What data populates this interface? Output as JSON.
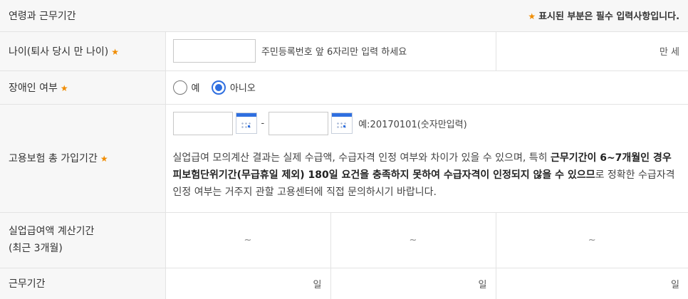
{
  "header": {
    "title": "연령과 근무기간",
    "required_note_star": "★",
    "required_note": "표시된 부분은 필수 입력사항입니다."
  },
  "age": {
    "label": "나이(퇴사 당시 만 나이)",
    "star": "★",
    "value": "",
    "hint": "주민등록번호 앞 6자리만 입력 하세요",
    "unit": "만 세"
  },
  "disability": {
    "label": "장애인 여부",
    "star": "★",
    "options": [
      {
        "label": "예",
        "checked": false
      },
      {
        "label": "아니오",
        "checked": true
      }
    ],
    "accent_color": "#2f6fe0"
  },
  "insurance": {
    "label": "고용보험 총 가입기간",
    "star": "★",
    "start_value": "",
    "end_value": "",
    "dash": "-",
    "date_hint": "예:20170101(숫자만입력)",
    "notice_part1": "실업급여 모의계산 결과는 실제 수급액, 수급자격 인정 여부와 차이가 있을 수 있으며, 특히 ",
    "notice_bold": "근무기간이 6~7개월인 경우 피보험단위기간(무급휴일 제외) 180일 요건을 충족하지 못하여 수급자격이 인정되지 않을 수 있으므",
    "notice_part2": "로 정확한 수급자격 인정 여부는 거주지 관할 고용센터에 직접 문의하시기 바랍니다."
  },
  "calc_period": {
    "label_line1": "실업급여액 계산기간",
    "label_line2": "(최근 3개월)",
    "ranges": [
      "~",
      "~",
      "~"
    ]
  },
  "work_period": {
    "label": "근무기간",
    "days": [
      "일",
      "일",
      "일"
    ]
  },
  "colors": {
    "star": "#f08c00",
    "label_bg": "#f7f7f7",
    "border": "#e3e3e3"
  }
}
